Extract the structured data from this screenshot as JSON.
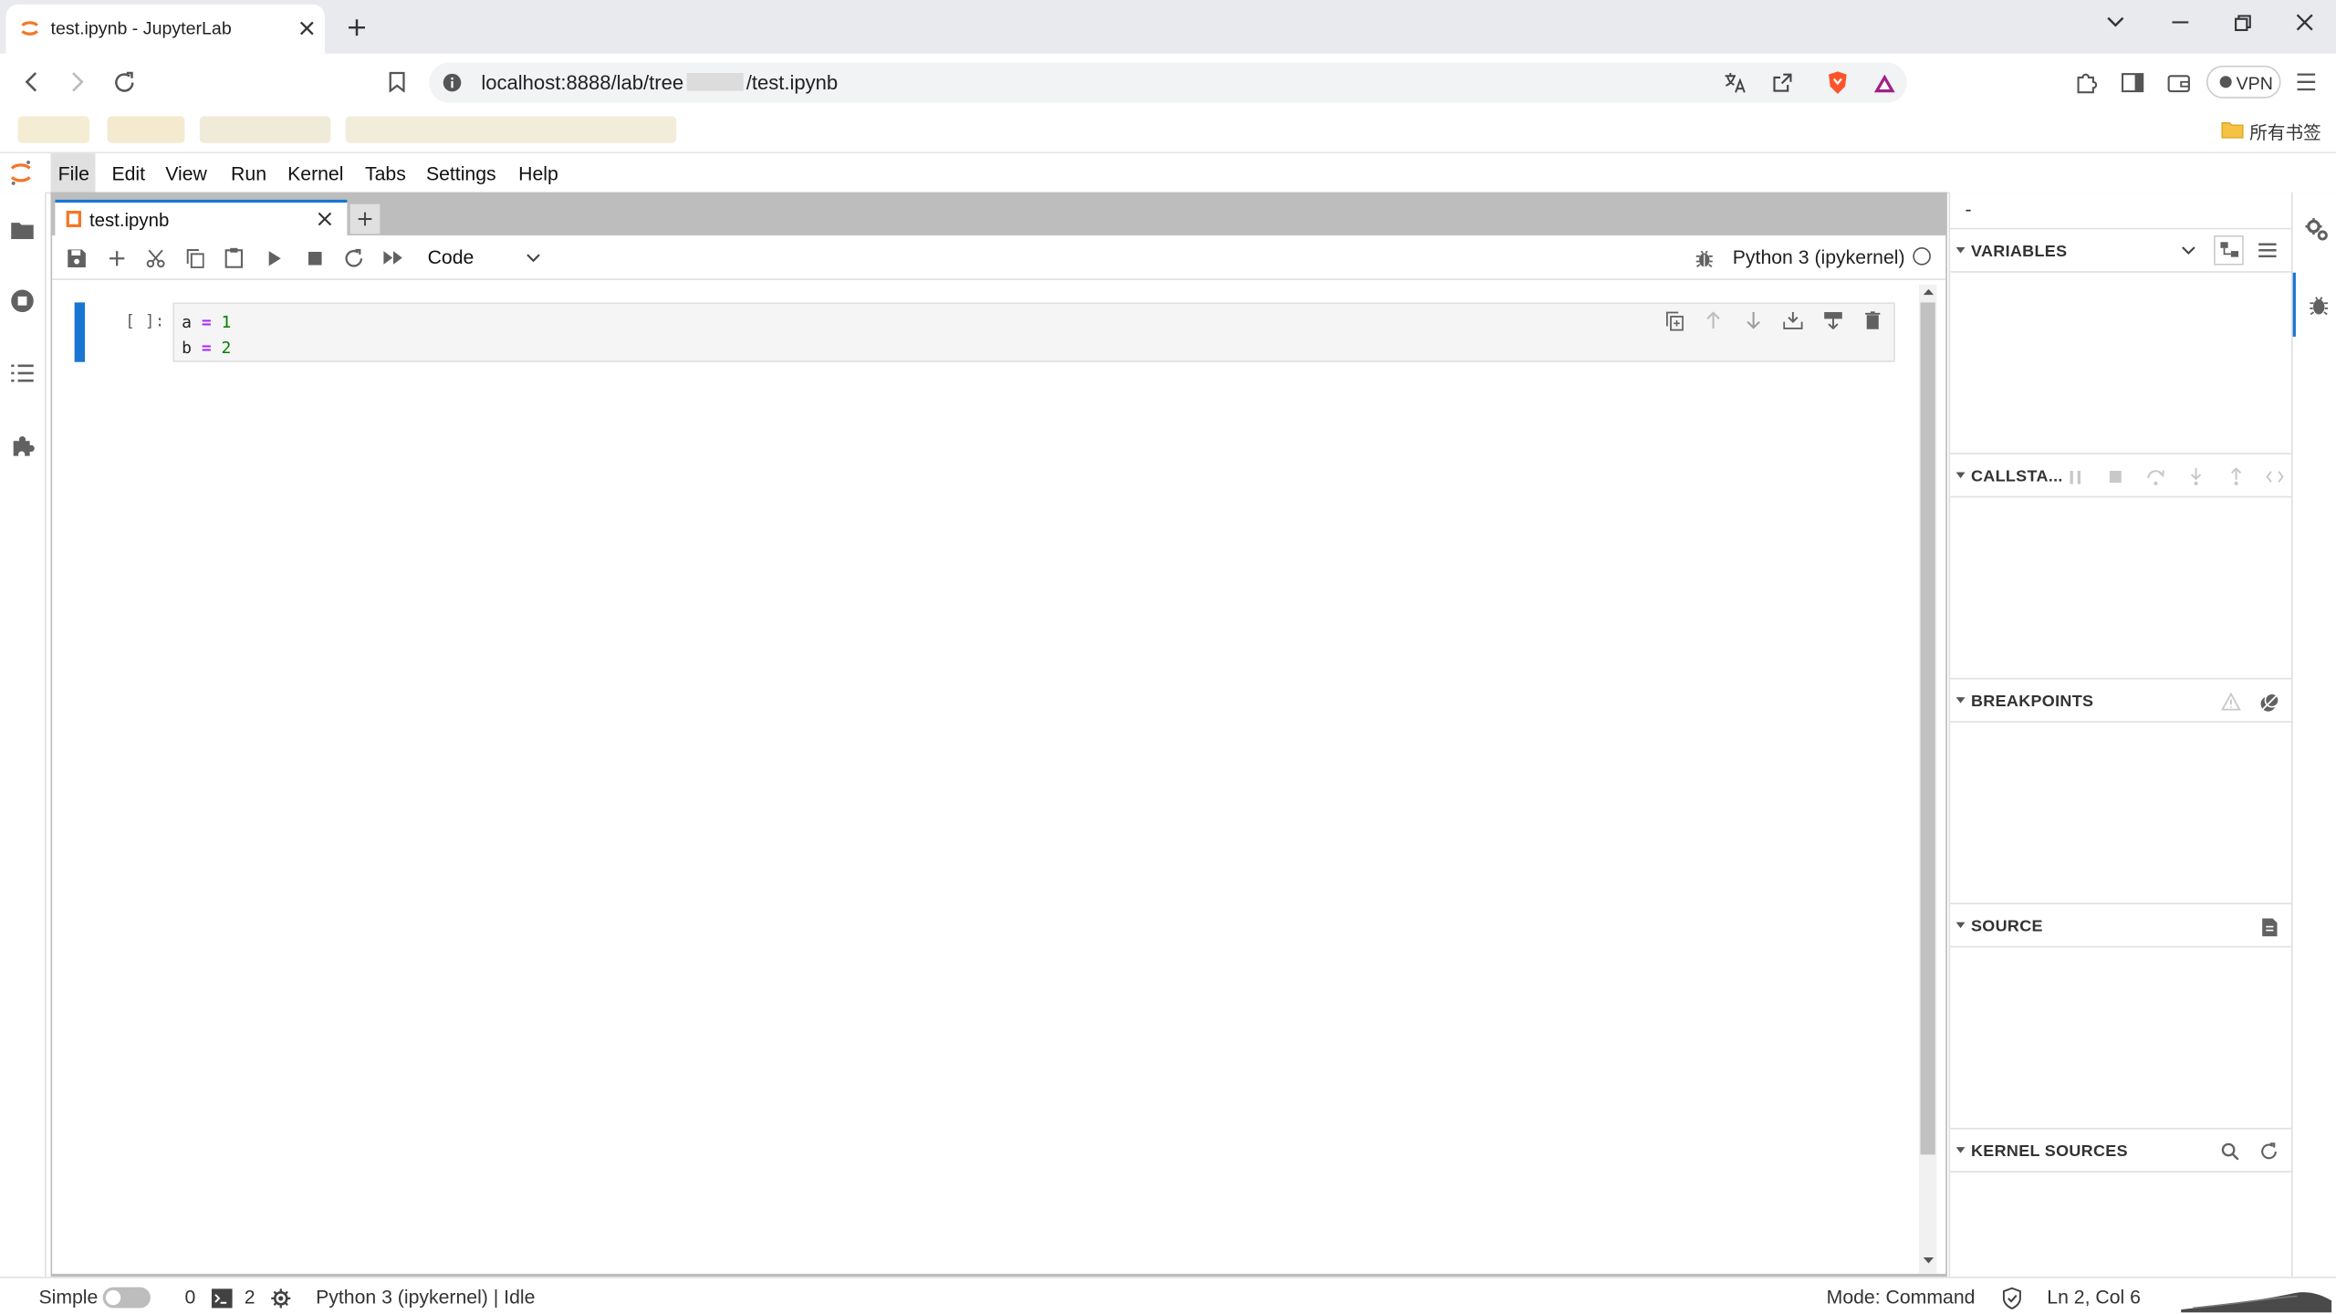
{
  "browser": {
    "tab_title": "test.ipynb - JupyterLab",
    "url_prefix": "localhost:8888/lab/tree",
    "url_suffix": "/test.ipynb",
    "vpn_label": "VPN",
    "bookmarks_folder_label": "所有书签"
  },
  "menubar": {
    "items": [
      "File",
      "Edit",
      "View",
      "Run",
      "Kernel",
      "Tabs",
      "Settings",
      "Help"
    ]
  },
  "notebook": {
    "tab_label": "test.ipynb",
    "cell_type": "Code",
    "kernel_name": "Python 3 (ipykernel)",
    "cell": {
      "prompt": "[ ]:",
      "lines": [
        {
          "var": "a",
          "op": "=",
          "num": "1"
        },
        {
          "var": "b",
          "op": "=",
          "num": "2"
        }
      ]
    }
  },
  "debugger": {
    "top_label": "-",
    "sections": {
      "variables": "VARIABLES",
      "callstack": "CALLSTA...",
      "breakpoints": "BREAKPOINTS",
      "source": "SOURCE",
      "kernel_sources": "KERNEL SOURCES"
    }
  },
  "statusbar": {
    "mode_label": "Simple",
    "terminals_count": "0",
    "kernels_count": "2",
    "kernel_status": "Python 3 (ipykernel) | Idle",
    "mode": "Mode: Command",
    "cursor": "Ln 2, Col 6"
  },
  "colors": {
    "accent": "#1976d2",
    "jupyter_orange": "#f37726",
    "code_keyword": "#aa22ff",
    "code_number": "#008000"
  }
}
